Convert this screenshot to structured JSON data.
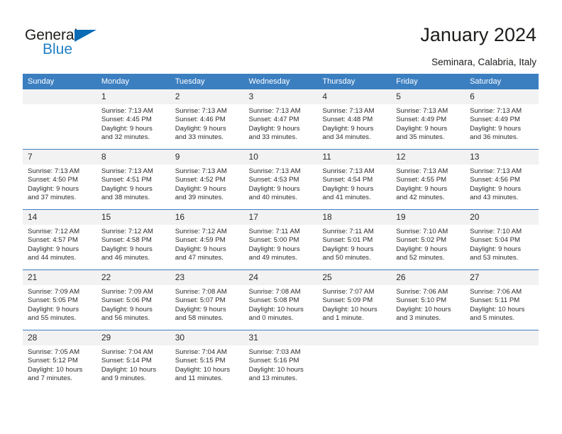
{
  "brand": {
    "line1": "General",
    "line2": "Blue",
    "accent_color": "#1f7fc4",
    "triangle_color": "#0b6cb5"
  },
  "header": {
    "title": "January 2024",
    "subtitle": "Seminara, Calabria, Italy"
  },
  "theme": {
    "header_bg": "#3c7fc1",
    "daynum_bg": "#f2f2f2",
    "cell_bg": "#ffffff",
    "text": "#2b2b2b"
  },
  "weekdays": [
    "Sunday",
    "Monday",
    "Tuesday",
    "Wednesday",
    "Thursday",
    "Friday",
    "Saturday"
  ],
  "weeks": [
    [
      {
        "day": "",
        "sunrise": "",
        "sunset": "",
        "daylight1": "",
        "daylight2": ""
      },
      {
        "day": "1",
        "sunrise": "Sunrise: 7:13 AM",
        "sunset": "Sunset: 4:45 PM",
        "daylight1": "Daylight: 9 hours",
        "daylight2": "and 32 minutes."
      },
      {
        "day": "2",
        "sunrise": "Sunrise: 7:13 AM",
        "sunset": "Sunset: 4:46 PM",
        "daylight1": "Daylight: 9 hours",
        "daylight2": "and 33 minutes."
      },
      {
        "day": "3",
        "sunrise": "Sunrise: 7:13 AM",
        "sunset": "Sunset: 4:47 PM",
        "daylight1": "Daylight: 9 hours",
        "daylight2": "and 33 minutes."
      },
      {
        "day": "4",
        "sunrise": "Sunrise: 7:13 AM",
        "sunset": "Sunset: 4:48 PM",
        "daylight1": "Daylight: 9 hours",
        "daylight2": "and 34 minutes."
      },
      {
        "day": "5",
        "sunrise": "Sunrise: 7:13 AM",
        "sunset": "Sunset: 4:49 PM",
        "daylight1": "Daylight: 9 hours",
        "daylight2": "and 35 minutes."
      },
      {
        "day": "6",
        "sunrise": "Sunrise: 7:13 AM",
        "sunset": "Sunset: 4:49 PM",
        "daylight1": "Daylight: 9 hours",
        "daylight2": "and 36 minutes."
      }
    ],
    [
      {
        "day": "7",
        "sunrise": "Sunrise: 7:13 AM",
        "sunset": "Sunset: 4:50 PM",
        "daylight1": "Daylight: 9 hours",
        "daylight2": "and 37 minutes."
      },
      {
        "day": "8",
        "sunrise": "Sunrise: 7:13 AM",
        "sunset": "Sunset: 4:51 PM",
        "daylight1": "Daylight: 9 hours",
        "daylight2": "and 38 minutes."
      },
      {
        "day": "9",
        "sunrise": "Sunrise: 7:13 AM",
        "sunset": "Sunset: 4:52 PM",
        "daylight1": "Daylight: 9 hours",
        "daylight2": "and 39 minutes."
      },
      {
        "day": "10",
        "sunrise": "Sunrise: 7:13 AM",
        "sunset": "Sunset: 4:53 PM",
        "daylight1": "Daylight: 9 hours",
        "daylight2": "and 40 minutes."
      },
      {
        "day": "11",
        "sunrise": "Sunrise: 7:13 AM",
        "sunset": "Sunset: 4:54 PM",
        "daylight1": "Daylight: 9 hours",
        "daylight2": "and 41 minutes."
      },
      {
        "day": "12",
        "sunrise": "Sunrise: 7:13 AM",
        "sunset": "Sunset: 4:55 PM",
        "daylight1": "Daylight: 9 hours",
        "daylight2": "and 42 minutes."
      },
      {
        "day": "13",
        "sunrise": "Sunrise: 7:13 AM",
        "sunset": "Sunset: 4:56 PM",
        "daylight1": "Daylight: 9 hours",
        "daylight2": "and 43 minutes."
      }
    ],
    [
      {
        "day": "14",
        "sunrise": "Sunrise: 7:12 AM",
        "sunset": "Sunset: 4:57 PM",
        "daylight1": "Daylight: 9 hours",
        "daylight2": "and 44 minutes."
      },
      {
        "day": "15",
        "sunrise": "Sunrise: 7:12 AM",
        "sunset": "Sunset: 4:58 PM",
        "daylight1": "Daylight: 9 hours",
        "daylight2": "and 46 minutes."
      },
      {
        "day": "16",
        "sunrise": "Sunrise: 7:12 AM",
        "sunset": "Sunset: 4:59 PM",
        "daylight1": "Daylight: 9 hours",
        "daylight2": "and 47 minutes."
      },
      {
        "day": "17",
        "sunrise": "Sunrise: 7:11 AM",
        "sunset": "Sunset: 5:00 PM",
        "daylight1": "Daylight: 9 hours",
        "daylight2": "and 49 minutes."
      },
      {
        "day": "18",
        "sunrise": "Sunrise: 7:11 AM",
        "sunset": "Sunset: 5:01 PM",
        "daylight1": "Daylight: 9 hours",
        "daylight2": "and 50 minutes."
      },
      {
        "day": "19",
        "sunrise": "Sunrise: 7:10 AM",
        "sunset": "Sunset: 5:02 PM",
        "daylight1": "Daylight: 9 hours",
        "daylight2": "and 52 minutes."
      },
      {
        "day": "20",
        "sunrise": "Sunrise: 7:10 AM",
        "sunset": "Sunset: 5:04 PM",
        "daylight1": "Daylight: 9 hours",
        "daylight2": "and 53 minutes."
      }
    ],
    [
      {
        "day": "21",
        "sunrise": "Sunrise: 7:09 AM",
        "sunset": "Sunset: 5:05 PM",
        "daylight1": "Daylight: 9 hours",
        "daylight2": "and 55 minutes."
      },
      {
        "day": "22",
        "sunrise": "Sunrise: 7:09 AM",
        "sunset": "Sunset: 5:06 PM",
        "daylight1": "Daylight: 9 hours",
        "daylight2": "and 56 minutes."
      },
      {
        "day": "23",
        "sunrise": "Sunrise: 7:08 AM",
        "sunset": "Sunset: 5:07 PM",
        "daylight1": "Daylight: 9 hours",
        "daylight2": "and 58 minutes."
      },
      {
        "day": "24",
        "sunrise": "Sunrise: 7:08 AM",
        "sunset": "Sunset: 5:08 PM",
        "daylight1": "Daylight: 10 hours",
        "daylight2": "and 0 minutes."
      },
      {
        "day": "25",
        "sunrise": "Sunrise: 7:07 AM",
        "sunset": "Sunset: 5:09 PM",
        "daylight1": "Daylight: 10 hours",
        "daylight2": "and 1 minute."
      },
      {
        "day": "26",
        "sunrise": "Sunrise: 7:06 AM",
        "sunset": "Sunset: 5:10 PM",
        "daylight1": "Daylight: 10 hours",
        "daylight2": "and 3 minutes."
      },
      {
        "day": "27",
        "sunrise": "Sunrise: 7:06 AM",
        "sunset": "Sunset: 5:11 PM",
        "daylight1": "Daylight: 10 hours",
        "daylight2": "and 5 minutes."
      }
    ],
    [
      {
        "day": "28",
        "sunrise": "Sunrise: 7:05 AM",
        "sunset": "Sunset: 5:12 PM",
        "daylight1": "Daylight: 10 hours",
        "daylight2": "and 7 minutes."
      },
      {
        "day": "29",
        "sunrise": "Sunrise: 7:04 AM",
        "sunset": "Sunset: 5:14 PM",
        "daylight1": "Daylight: 10 hours",
        "daylight2": "and 9 minutes."
      },
      {
        "day": "30",
        "sunrise": "Sunrise: 7:04 AM",
        "sunset": "Sunset: 5:15 PM",
        "daylight1": "Daylight: 10 hours",
        "daylight2": "and 11 minutes."
      },
      {
        "day": "31",
        "sunrise": "Sunrise: 7:03 AM",
        "sunset": "Sunset: 5:16 PM",
        "daylight1": "Daylight: 10 hours",
        "daylight2": "and 13 minutes."
      },
      {
        "day": "",
        "sunrise": "",
        "sunset": "",
        "daylight1": "",
        "daylight2": ""
      },
      {
        "day": "",
        "sunrise": "",
        "sunset": "",
        "daylight1": "",
        "daylight2": ""
      },
      {
        "day": "",
        "sunrise": "",
        "sunset": "",
        "daylight1": "",
        "daylight2": ""
      }
    ]
  ]
}
